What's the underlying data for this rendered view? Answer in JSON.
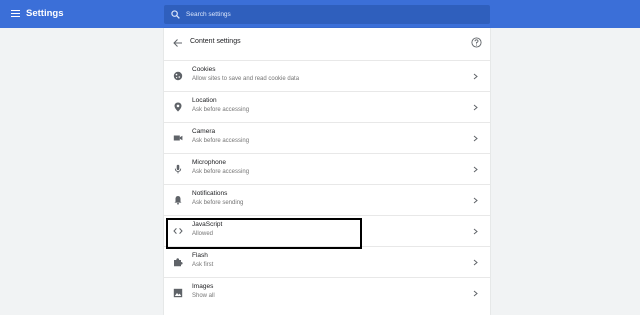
{
  "header": {
    "title": "Settings",
    "search_placeholder": "Search settings"
  },
  "panel": {
    "title": "Content settings",
    "items": [
      {
        "title": "Cookies",
        "subtitle": "Allow sites to save and read cookie data",
        "icon": "cookie-icon"
      },
      {
        "title": "Location",
        "subtitle": "Ask before accessing",
        "icon": "location-pin-icon"
      },
      {
        "title": "Camera",
        "subtitle": "Ask before accessing",
        "icon": "camera-icon"
      },
      {
        "title": "Microphone",
        "subtitle": "Ask before accessing",
        "icon": "microphone-icon"
      },
      {
        "title": "Notifications",
        "subtitle": "Ask before sending",
        "icon": "bell-icon"
      },
      {
        "title": "JavaScript",
        "subtitle": "Allowed",
        "icon": "code-brackets-icon"
      },
      {
        "title": "Flash",
        "subtitle": "Ask first",
        "icon": "puzzle-icon"
      },
      {
        "title": "Images",
        "subtitle": "Show all",
        "icon": "image-icon"
      }
    ]
  },
  "colors": {
    "topbar": "#3b6fd8",
    "search_box": "#2f5fbd",
    "background": "#f1f3f4",
    "highlight_border": "#000000"
  }
}
